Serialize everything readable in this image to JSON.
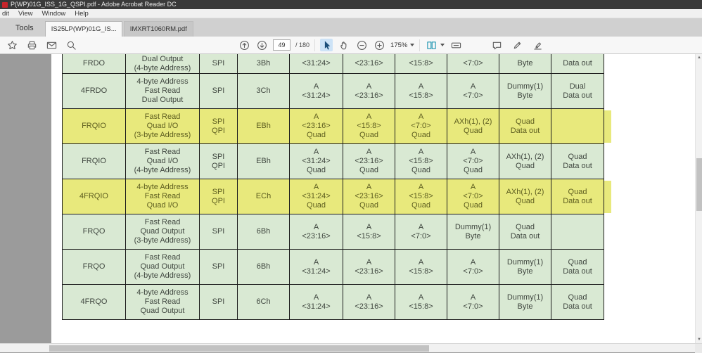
{
  "titlebar": {
    "title": "P(WP)01G_ISS_1G_QSPI.pdf - Adobe Acrobat Reader DC"
  },
  "menubar": {
    "items": [
      "dit",
      "View",
      "Window",
      "Help"
    ]
  },
  "tabbar": {
    "tools": "Tools",
    "tabs": [
      {
        "label": "IS25LP(WP)01G_IS...",
        "close": "×"
      },
      {
        "label": "IMXRT1060RM.pdf"
      }
    ]
  },
  "toolbar": {
    "page_number": "49",
    "page_total": "/ 180",
    "zoom": "175%",
    "icons": [
      "favorites-star",
      "print",
      "email",
      "search",
      "page-up",
      "page-down",
      "select-tool",
      "hand-tool",
      "zoom-out",
      "zoom-in",
      "page-display",
      "scroll-mode",
      "comment",
      "draw-pen",
      "highlighter"
    ]
  },
  "table": {
    "rows": [
      {
        "partial": true,
        "name": "FRDO",
        "desc": "Dual Output\n(4-byte Address)",
        "mode": "SPI",
        "op": "3Bh",
        "b1": "<31:24>",
        "b2": "<23:16>",
        "b3": "<15:8>",
        "b4": "<7:0>",
        "b5": "Byte",
        "b6": "Data out"
      },
      {
        "name": "4FRDO",
        "desc": "4-byte Address\nFast Read\nDual Output",
        "mode": "SPI",
        "op": "3Ch",
        "b1": "A\n<31:24>",
        "b2": "A\n<23:16>",
        "b3": "A\n<15:8>",
        "b4": "A\n<7:0>",
        "b5": "Dummy(1)\nByte",
        "b6": "Dual\nData out"
      },
      {
        "hl": true,
        "name": "FRQIO",
        "desc": "Fast Read\nQuad I/O\n(3-byte Address)",
        "mode": "SPI\nQPI",
        "op": "EBh",
        "b1": "A\n<23:16>\nQuad",
        "b2": "A\n<15:8>\nQuad",
        "b3": "A\n<7:0>\nQuad",
        "b4": "AXh(1), (2)\nQuad",
        "b5": "Quad\nData out",
        "b6": ""
      },
      {
        "name": "FRQIO",
        "desc": "Fast Read\nQuad I/O\n(4-byte Address)",
        "mode": "SPI\nQPI",
        "op": "EBh",
        "b1": "A\n<31:24>\nQuad",
        "b2": "A\n<23:16>\nQuad",
        "b3": "A\n<15:8>\nQuad",
        "b4": "A\n<7:0>\nQuad",
        "b5": "AXh(1), (2)\nQuad",
        "b6": "Quad\nData out"
      },
      {
        "hl": true,
        "name": "4FRQIO",
        "desc": "4-byte Address\nFast Read\nQuad I/O",
        "mode": "SPI\nQPI",
        "op": "ECh",
        "b1": "A\n<31:24>\nQuad",
        "b2": "A\n<23:16>\nQuad",
        "b3": "A\n<15:8>\nQuad",
        "b4": "A\n<7:0>\nQuad",
        "b5": "AXh(1), (2)\nQuad",
        "b6": "Quad\nData out"
      },
      {
        "name": "FRQO",
        "desc": "Fast Read\nQuad Output\n(3-byte Address)",
        "mode": "SPI",
        "op": "6Bh",
        "b1": "A\n<23:16>",
        "b2": "A\n<15:8>",
        "b3": "A\n<7:0>",
        "b4": "Dummy(1)\nByte",
        "b5": "Quad\nData out",
        "b6": ""
      },
      {
        "name": "FRQO",
        "desc": "Fast Read\nQuad Output\n(4-byte Address)",
        "mode": "SPI",
        "op": "6Bh",
        "b1": "A\n<31:24>",
        "b2": "A\n<23:16>",
        "b3": "A\n<15:8>",
        "b4": "A\n<7:0>",
        "b5": "Dummy(1)\nByte",
        "b6": "Quad\nData out"
      },
      {
        "name": "4FRQO",
        "desc": "4-byte Address\nFast Read\nQuad Output",
        "mode": "SPI",
        "op": "6Ch",
        "b1": "A\n<31:24>",
        "b2": "A\n<23:16>",
        "b3": "A\n<15:8>",
        "b4": "A\n<7:0>",
        "b5": "Dummy(1)\nByte",
        "b6": "Quad\nData out"
      }
    ]
  }
}
